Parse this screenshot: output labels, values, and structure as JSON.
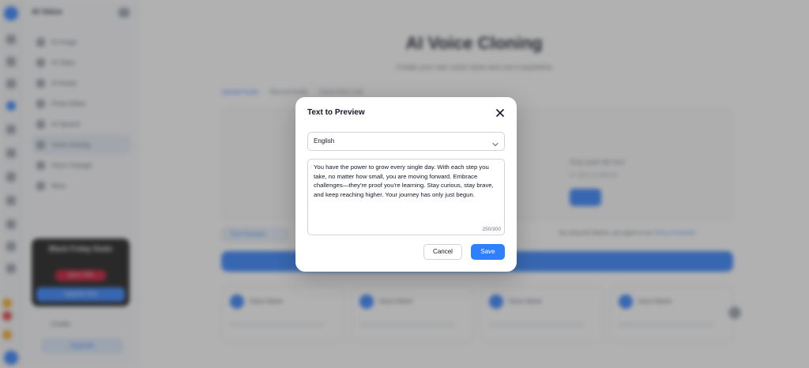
{
  "app": {
    "brand": "AI Voice",
    "nav_items": [
      {
        "label": "AI Image"
      },
      {
        "label": "AI Video"
      },
      {
        "label": "AI Avatar"
      },
      {
        "label": "Photo Editor"
      },
      {
        "label": "AI Speech"
      },
      {
        "label": "Voice Cloning"
      },
      {
        "label": "Voice Changer"
      },
      {
        "label": "More"
      }
    ],
    "promo": {
      "title": "Black Friday Deals",
      "badge": "Up to 70%",
      "cta": "Upgrade Now"
    },
    "footer_label": "Credits",
    "footer_button": "Upgrade"
  },
  "page": {
    "title": "AI Voice Cloning",
    "subtitle": "Create your own voice clone and use it anywhere",
    "tabs": [
      "Upload Audio",
      "Record Audio",
      "Clone from Link"
    ],
    "panel_line1": "Drop audio file here",
    "panel_line2": "or click to upload",
    "preview_button": "Text Preview",
    "terms_text": "By using this feature, you agree to our ",
    "terms_link": "Terms of Service",
    "voice_cards": [
      "Voice Name",
      "Voice Name",
      "Voice Name",
      "Voice Name"
    ]
  },
  "modal": {
    "title": "Text to Preview",
    "close_icon": "close-icon",
    "language": "English",
    "text": "You have the power to grow every single day. With each step you take, no matter how small, you are moving forward. Embrace challenges—they're proof you're learning. Stay curious, stay brave, and keep reaching higher. Your journey has only just begun.",
    "char_count": "250/300",
    "cancel_label": "Cancel",
    "save_label": "Save"
  },
  "colors": {
    "accent": "#2f80ff",
    "overlay": "rgba(70,70,70,0.42)"
  }
}
